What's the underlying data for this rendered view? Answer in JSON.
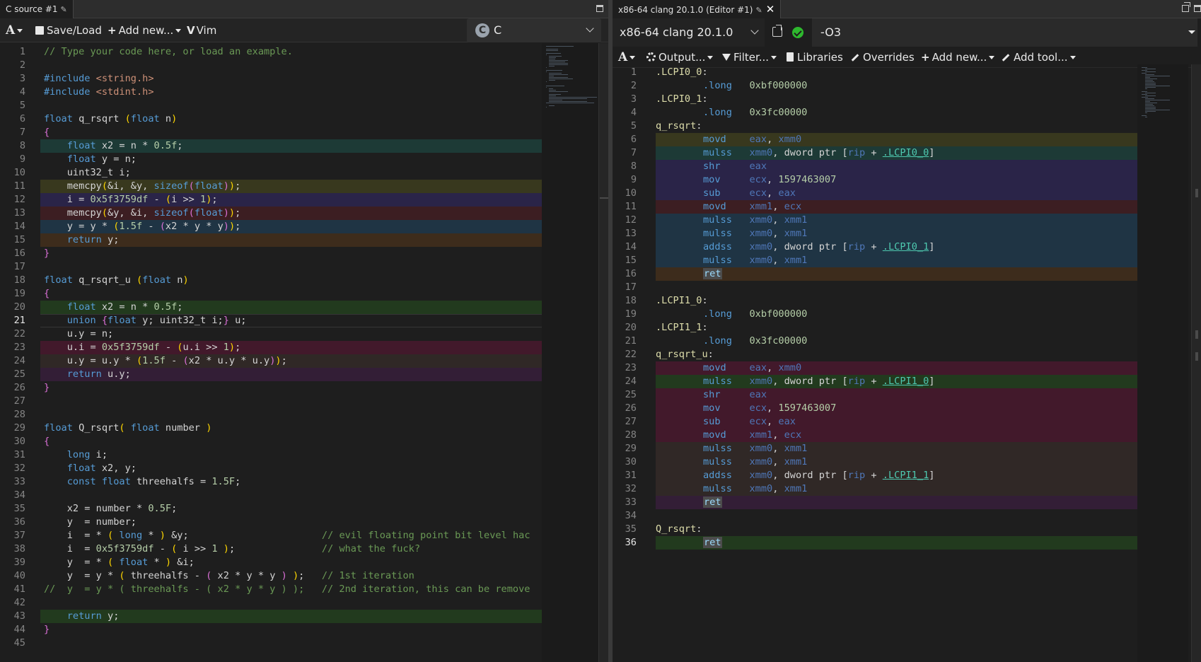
{
  "left": {
    "tab_title": "C source #1",
    "toolbar": {
      "save_load": "Save/Load",
      "add_new": "Add new...",
      "vim": "Vim",
      "language": "C"
    }
  },
  "right": {
    "tab_title": "x86-64 clang 20.1.0 (Editor #1)",
    "compiler": "x86-64 clang 20.1.0",
    "options": "-O3",
    "toolbar": {
      "output": "Output...",
      "filter": "Filter...",
      "libraries": "Libraries",
      "overrides": "Overrides",
      "add_new": "Add new...",
      "add_tool": "Add tool..."
    }
  },
  "colors": {
    "bg": "#1e1e1e",
    "hl_teal": "#1d3a36",
    "hl_olive": "#38381e",
    "hl_indigo": "#2a2448",
    "hl_maroon": "#3c1e22",
    "hl_slate": "#1f3444",
    "hl_brown": "#3d2c1c",
    "hl_green": "#223a1e",
    "hl_crimson": "#42192b",
    "hl_taupe": "#302826",
    "hl_plum": "#331e36"
  },
  "source_lines": [
    {
      "n": "1",
      "text": "// Type your code here, or load an example."
    },
    {
      "n": "2",
      "text": ""
    },
    {
      "n": "3",
      "text": "#include <string.h>"
    },
    {
      "n": "4",
      "text": "#include <stdint.h>"
    },
    {
      "n": "5",
      "text": ""
    },
    {
      "n": "6",
      "text": "float q_rsqrt (float n)"
    },
    {
      "n": "7",
      "text": "{"
    },
    {
      "n": "8",
      "text": "    float x2 = n * 0.5f;",
      "hl": "hl_teal"
    },
    {
      "n": "9",
      "text": "    float y = n;"
    },
    {
      "n": "10",
      "text": "    uint32_t i;"
    },
    {
      "n": "11",
      "text": "    memcpy(&i, &y, sizeof(float));",
      "hl": "hl_olive"
    },
    {
      "n": "12",
      "text": "    i = 0x5f3759df - (i >> 1);",
      "hl": "hl_indigo"
    },
    {
      "n": "13",
      "text": "    memcpy(&y, &i, sizeof(float));",
      "hl": "hl_maroon"
    },
    {
      "n": "14",
      "text": "    y = y * (1.5f - (x2 * y * y));",
      "hl": "hl_slate"
    },
    {
      "n": "15",
      "text": "    return y;",
      "hl": "hl_brown"
    },
    {
      "n": "16",
      "text": "}"
    },
    {
      "n": "17",
      "text": ""
    },
    {
      "n": "18",
      "text": "float q_rsqrt_u (float n)"
    },
    {
      "n": "19",
      "text": "{"
    },
    {
      "n": "20",
      "text": "    float x2 = n * 0.5f;",
      "hl": "hl_green"
    },
    {
      "n": "21",
      "text": "    union {float y; uint32_t i;} u;",
      "active": true
    },
    {
      "n": "22",
      "text": "    u.y = n;"
    },
    {
      "n": "23",
      "text": "    u.i = 0x5f3759df - (u.i >> 1);",
      "hl": "hl_crimson"
    },
    {
      "n": "24",
      "text": "    u.y = u.y * (1.5f - (x2 * u.y * u.y));",
      "hl": "hl_taupe"
    },
    {
      "n": "25",
      "text": "    return u.y;",
      "hl": "hl_plum"
    },
    {
      "n": "26",
      "text": "}"
    },
    {
      "n": "27",
      "text": ""
    },
    {
      "n": "28",
      "text": ""
    },
    {
      "n": "29",
      "text": "float Q_rsqrt( float number )"
    },
    {
      "n": "30",
      "text": "{"
    },
    {
      "n": "31",
      "text": "    long i;"
    },
    {
      "n": "32",
      "text": "    float x2, y;"
    },
    {
      "n": "33",
      "text": "    const float threehalfs = 1.5F;"
    },
    {
      "n": "34",
      "text": ""
    },
    {
      "n": "35",
      "text": "    x2 = number * 0.5F;"
    },
    {
      "n": "36",
      "text": "    y  = number;"
    },
    {
      "n": "37",
      "text": "    i  = * ( long * ) &y;                       // evil floating point bit level hac"
    },
    {
      "n": "38",
      "text": "    i  = 0x5f3759df - ( i >> 1 );               // what the fuck?"
    },
    {
      "n": "39",
      "text": "    y  = * ( float * ) &i;"
    },
    {
      "n": "40",
      "text": "    y  = y * ( threehalfs - ( x2 * y * y ) );   // 1st iteration"
    },
    {
      "n": "41",
      "text": "//  y  = y * ( threehalfs - ( x2 * y * y ) );   // 2nd iteration, this can be remove"
    },
    {
      "n": "42",
      "text": ""
    },
    {
      "n": "43",
      "text": "    return y;",
      "hl": "hl_green"
    },
    {
      "n": "44",
      "text": "}"
    },
    {
      "n": "45",
      "text": ""
    }
  ],
  "asm_lines": [
    {
      "n": "1",
      "label": ".LCPI0_0:"
    },
    {
      "n": "2",
      "op": ".long",
      "args": "0xbf000000",
      "kind": "dir"
    },
    {
      "n": "3",
      "label": ".LCPI0_1:"
    },
    {
      "n": "4",
      "op": ".long",
      "args": "0x3fc00000",
      "kind": "dir"
    },
    {
      "n": "5",
      "label": "q_rsqrt:"
    },
    {
      "n": "6",
      "op": "movd",
      "args": "eax, xmm0",
      "hl": "hl_olive"
    },
    {
      "n": "7",
      "op": "mulss",
      "args": "xmm0, dword ptr [rip + .LCPI0_0]",
      "hl": "hl_teal"
    },
    {
      "n": "8",
      "op": "shr",
      "args": "eax",
      "hl": "hl_indigo"
    },
    {
      "n": "9",
      "op": "mov",
      "args": "ecx, 1597463007",
      "hl": "hl_indigo"
    },
    {
      "n": "10",
      "op": "sub",
      "args": "ecx, eax",
      "hl": "hl_indigo"
    },
    {
      "n": "11",
      "op": "movd",
      "args": "xmm1, ecx",
      "hl": "hl_maroon"
    },
    {
      "n": "12",
      "op": "mulss",
      "args": "xmm0, xmm1",
      "hl": "hl_slate"
    },
    {
      "n": "13",
      "op": "mulss",
      "args": "xmm0, xmm1",
      "hl": "hl_slate"
    },
    {
      "n": "14",
      "op": "addss",
      "args": "xmm0, dword ptr [rip + .LCPI0_1]",
      "hl": "hl_slate"
    },
    {
      "n": "15",
      "op": "mulss",
      "args": "xmm0, xmm1",
      "hl": "hl_slate"
    },
    {
      "n": "16",
      "op": "ret",
      "args": "",
      "hl": "hl_brown"
    },
    {
      "n": "17"
    },
    {
      "n": "18",
      "label": ".LCPI1_0:"
    },
    {
      "n": "19",
      "op": ".long",
      "args": "0xbf000000",
      "kind": "dir"
    },
    {
      "n": "20",
      "label": ".LCPI1_1:"
    },
    {
      "n": "21",
      "op": ".long",
      "args": "0x3fc00000",
      "kind": "dir"
    },
    {
      "n": "22",
      "label": "q_rsqrt_u:"
    },
    {
      "n": "23",
      "op": "movd",
      "args": "eax, xmm0",
      "hl": "hl_crimson"
    },
    {
      "n": "24",
      "op": "mulss",
      "args": "xmm0, dword ptr [rip + .LCPI1_0]",
      "hl": "hl_green"
    },
    {
      "n": "25",
      "op": "shr",
      "args": "eax",
      "hl": "hl_crimson"
    },
    {
      "n": "26",
      "op": "mov",
      "args": "ecx, 1597463007",
      "hl": "hl_crimson"
    },
    {
      "n": "27",
      "op": "sub",
      "args": "ecx, eax",
      "hl": "hl_crimson"
    },
    {
      "n": "28",
      "op": "movd",
      "args": "xmm1, ecx",
      "hl": "hl_crimson"
    },
    {
      "n": "29",
      "op": "mulss",
      "args": "xmm0, xmm1",
      "hl": "hl_taupe"
    },
    {
      "n": "30",
      "op": "mulss",
      "args": "xmm0, xmm1",
      "hl": "hl_taupe"
    },
    {
      "n": "31",
      "op": "addss",
      "args": "xmm0, dword ptr [rip + .LCPI1_1]",
      "hl": "hl_taupe"
    },
    {
      "n": "32",
      "op": "mulss",
      "args": "xmm0, xmm1",
      "hl": "hl_taupe"
    },
    {
      "n": "33",
      "op": "ret",
      "args": "",
      "hl": "hl_plum"
    },
    {
      "n": "34"
    },
    {
      "n": "35",
      "label": "Q_rsqrt:"
    },
    {
      "n": "36",
      "op": "ret",
      "args": "",
      "hl": "hl_green",
      "active": true
    }
  ]
}
